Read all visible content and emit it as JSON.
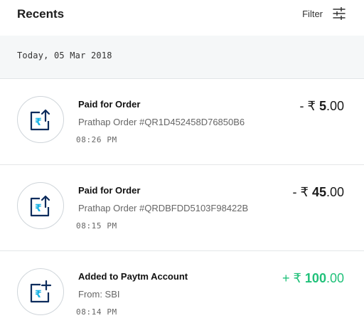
{
  "header": {
    "title": "Recents",
    "filter_label": "Filter",
    "filter_icon": "sliders-icon"
  },
  "date_header": "Today, 05 Mar 2018",
  "colors": {
    "credit": "#21c17a",
    "icon_navy": "#0d2c5d",
    "icon_cyan": "#19b3e6",
    "date_bar_bg": "#f5f7f8"
  },
  "transactions": [
    {
      "name": "Paid for Order",
      "detail": "Prathap Order #QR1D452458D76850B6",
      "time": "08:26 PM",
      "amount_prefix": "- ₹ ",
      "amount_int": "5",
      "amount_dec": ".00",
      "type": "debit",
      "icon": "payment-sent-icon"
    },
    {
      "name": "Paid for Order",
      "detail": "Prathap Order #QRDBFDD5103F98422B",
      "time": "08:15 PM",
      "amount_prefix": "- ₹ ",
      "amount_int": "45",
      "amount_dec": ".00",
      "type": "debit",
      "icon": "payment-sent-icon"
    },
    {
      "name": "Added to Paytm Account",
      "detail": "From: SBI",
      "time": "08:14 PM",
      "amount_prefix": "+ ₹ ",
      "amount_int": "100",
      "amount_dec": ".00",
      "type": "credit",
      "icon": "money-added-icon"
    }
  ]
}
